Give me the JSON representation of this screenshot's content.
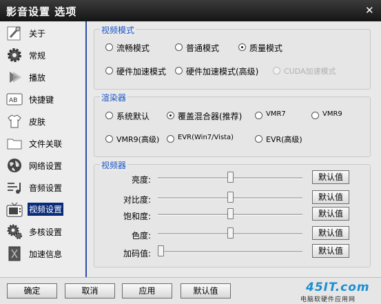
{
  "window": {
    "title": "影音设置 选项",
    "close_glyph": "✕"
  },
  "sidebar": {
    "items": [
      {
        "label": "关于",
        "icon": "wrench-icon"
      },
      {
        "label": "常规",
        "icon": "gear-icon"
      },
      {
        "label": "播放",
        "icon": "play-icon"
      },
      {
        "label": "快捷键",
        "icon": "keyboard-icon"
      },
      {
        "label": "皮肤",
        "icon": "shirt-icon"
      },
      {
        "label": "文件关联",
        "icon": "folder-icon"
      },
      {
        "label": "网络设置",
        "icon": "globe-icon"
      },
      {
        "label": "音频设置",
        "icon": "audio-icon"
      },
      {
        "label": "视频设置",
        "icon": "tv-icon"
      },
      {
        "label": "多核设置",
        "icon": "chip-icon"
      },
      {
        "label": "加速信息",
        "icon": "document-icon"
      }
    ],
    "active_index": 8
  },
  "video_mode": {
    "title": "视频模式",
    "options": [
      "流畅模式",
      "普通模式",
      "质量模式",
      "硬件加速模式",
      "硬件加速模式(高级)",
      "CUDA加速模式"
    ],
    "selected": "质量模式",
    "disabled": [
      "CUDA加速模式"
    ]
  },
  "renderer": {
    "title": "渲染器",
    "options": [
      "系统默认",
      "覆盖混合器(推荐)",
      "VMR7",
      "VMR9",
      "VMR9(高级)",
      "EVR(Win7/Vista)",
      "EVR(高级)"
    ],
    "selected": "覆盖混合器(推荐)"
  },
  "video_adjust": {
    "title": "视频器",
    "default_label": "默认值",
    "sliders": [
      {
        "label": "亮度:",
        "value": 0.5
      },
      {
        "label": "对比度:",
        "value": 0.5
      },
      {
        "label": "饱和度:",
        "value": 0.5
      },
      {
        "label": "色度:",
        "value": 0.5
      },
      {
        "label": "加码值:",
        "value": 0.0
      }
    ]
  },
  "footer": {
    "ok_label": "确定",
    "cancel_label": "取消",
    "apply_label": "应用",
    "default_label": "默认值"
  },
  "watermark": {
    "line1": "45IT.com",
    "line2": "电脑软硬件应用网"
  }
}
